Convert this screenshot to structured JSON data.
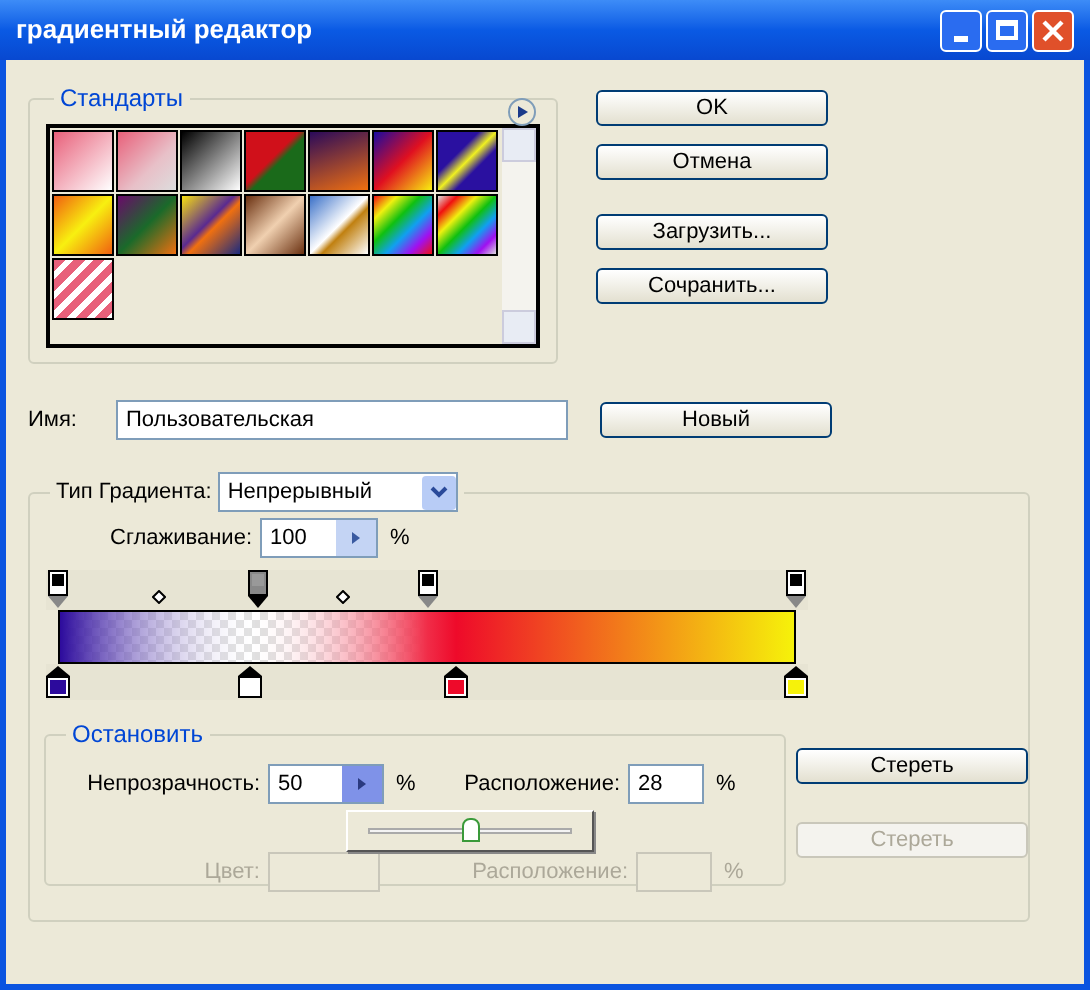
{
  "window": {
    "title": "градиентный редактор"
  },
  "presets": {
    "title": "Стандарты"
  },
  "buttons": [
    {
      "label": "OK"
    },
    {
      "label": "Отмена"
    },
    {
      "label": "Загрузить..."
    },
    {
      "label": "Сочранить..."
    }
  ],
  "name": {
    "label": "Имя:",
    "value": "Пользовательская",
    "button": "Новый"
  },
  "gradient": {
    "type_label": "Тип Градиента:",
    "type_value": "Непрерывный",
    "smoothing_label": "Сглаживание:",
    "smoothing_value": "100",
    "smoothing_unit": "%",
    "opacity_stops": [
      {
        "level": 0,
        "selected": false
      },
      {
        "level": 0.27,
        "selected": true
      },
      {
        "level": 0.5,
        "selected": false
      },
      {
        "level": 1,
        "selected": false
      }
    ],
    "color_stops": [
      {
        "level": 0,
        "color": "#2c0a9c",
        "selected": false
      },
      {
        "level": 0.26,
        "color": "#ffffff",
        "selected": false
      },
      {
        "level": 0.54,
        "color": "#ee0a2a",
        "selected": false
      },
      {
        "level": 1,
        "color": "#f6f20a",
        "selected": false
      }
    ]
  },
  "stops": {
    "title": "Остановить",
    "opacity_label": "Непрозрачность:",
    "opacity_value": "50",
    "opacity_unit": "%",
    "location_label": "Расположение:",
    "location_value": "28",
    "location_unit": "%",
    "delete": "Стереть",
    "color_label": "Цвет:",
    "color_location_label": "Расположение:",
    "color_unit": "%",
    "color_delete": "Стереть",
    "color_disabled": true,
    "slider": {
      "level": 0.5
    }
  }
}
